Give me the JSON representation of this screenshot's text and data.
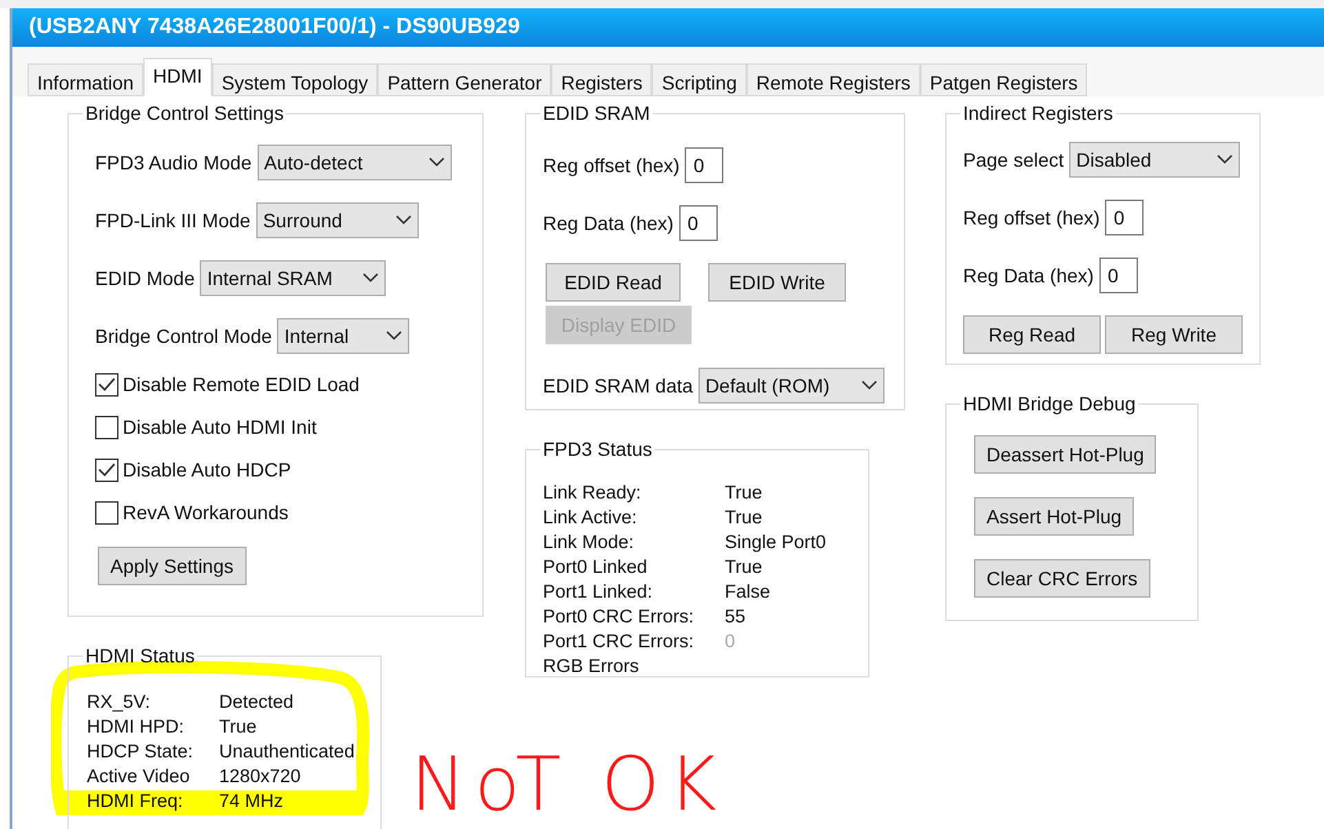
{
  "window": {
    "title": "(USB2ANY 7438A26E28001F00/1) - DS90UB929"
  },
  "tabs": [
    {
      "label": "Information",
      "selected": false
    },
    {
      "label": "HDMI",
      "selected": true
    },
    {
      "label": "System Topology",
      "selected": false
    },
    {
      "label": "Pattern Generator",
      "selected": false
    },
    {
      "label": "Registers",
      "selected": false
    },
    {
      "label": "Scripting",
      "selected": false
    },
    {
      "label": "Remote Registers",
      "selected": false
    },
    {
      "label": "Patgen Registers",
      "selected": false
    }
  ],
  "bridge_control": {
    "title": "Bridge Control Settings",
    "dropdowns": [
      {
        "label": "FPD3 Audio Mode",
        "value": "Auto-detect"
      },
      {
        "label": "FPD-Link III Mode",
        "value": "Surround"
      },
      {
        "label": "EDID Mode",
        "value": "Internal SRAM"
      },
      {
        "label": "Bridge Control Mode",
        "value": "Internal"
      }
    ],
    "checkboxes": [
      {
        "label": "Disable Remote EDID Load",
        "checked": true
      },
      {
        "label": "Disable Auto HDMI Init",
        "checked": false
      },
      {
        "label": "Disable Auto HDCP",
        "checked": true
      },
      {
        "label": "RevA Workarounds",
        "checked": false
      }
    ],
    "button": "Apply Settings"
  },
  "hdmi_status": {
    "title": "HDMI Status",
    "highlighted": true,
    "rows": [
      {
        "label": "RX_5V:",
        "value": "Detected"
      },
      {
        "label": "HDMI HPD:",
        "value": "True"
      },
      {
        "label": "HDCP State:",
        "value": "Unauthenticated"
      },
      {
        "label": "Active Video",
        "value": "1280x720"
      },
      {
        "label": "HDMI Freq:",
        "value": "74 MHz"
      }
    ]
  },
  "edid_sram": {
    "title": "EDID SRAM",
    "fields": [
      {
        "label": "Reg offset (hex)",
        "value": "0"
      },
      {
        "label": "Reg Data (hex)",
        "value": "0"
      }
    ],
    "buttons": [
      {
        "label": "EDID Read",
        "disabled": false
      },
      {
        "label": "EDID Write",
        "disabled": false
      },
      {
        "label": "Display EDID",
        "disabled": true
      }
    ],
    "data_dropdown": {
      "label": "EDID SRAM data",
      "value": "Default (ROM)"
    }
  },
  "fpd3_status": {
    "title": "FPD3 Status",
    "rows": [
      {
        "label": "Link Ready:",
        "value": "True",
        "dimmed": false
      },
      {
        "label": "Link Active:",
        "value": "True",
        "dimmed": false
      },
      {
        "label": "Link Mode:",
        "value": "Single Port0",
        "dimmed": false
      },
      {
        "label": "Port0 Linked",
        "value": "True",
        "dimmed": false
      },
      {
        "label": "Port1 Linked:",
        "value": "False",
        "dimmed": false
      },
      {
        "label": "Port0 CRC Errors:",
        "value": "55",
        "dimmed": false
      },
      {
        "label": "Port1 CRC Errors:",
        "value": "0",
        "dimmed": true
      },
      {
        "label": "RGB Errors"
      }
    ]
  },
  "indirect_registers": {
    "title": "Indirect Registers",
    "page_select": {
      "label": "Page select",
      "value": "Disabled"
    },
    "fields": [
      {
        "label": "Reg offset (hex)",
        "value": "0"
      },
      {
        "label": "Reg Data (hex)",
        "value": "0"
      }
    ],
    "buttons": [
      "Reg Read",
      "Reg Write"
    ]
  },
  "bridge_debug": {
    "title": "HDMI Bridge Debug",
    "buttons": [
      "Deassert Hot-Plug",
      "Assert Hot-Plug",
      "Clear CRC Errors"
    ]
  },
  "annotation": {
    "text": "NoT OK"
  }
}
